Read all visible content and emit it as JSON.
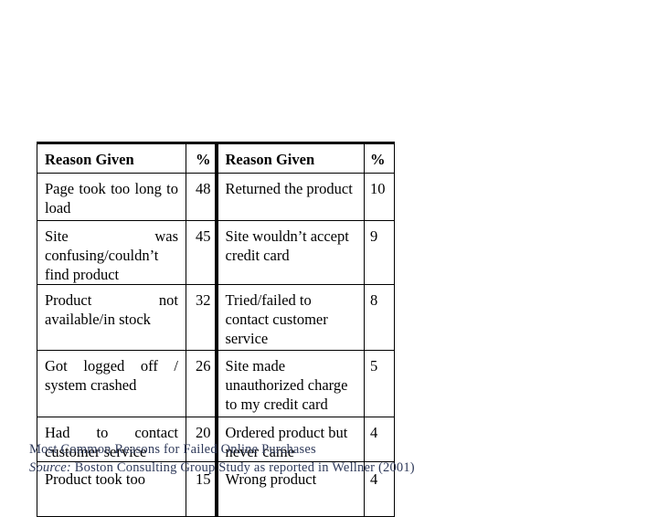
{
  "table": {
    "headers": [
      "Reason Given",
      "%",
      "Reason Given",
      "%"
    ],
    "rows": [
      {
        "reason_a": "Page took too long to load",
        "pct_a": "48",
        "reason_b": "Returned the product",
        "pct_b": "10"
      },
      {
        "reason_a": "Site was confusing/couldn’t find product",
        "pct_a": "45",
        "reason_b": "Site wouldn’t accept credit card",
        "pct_b": "9"
      },
      {
        "reason_a": "Product not available/in stock",
        "pct_a": "32",
        "reason_b": "Tried/failed to contact customer service",
        "pct_b": "8"
      },
      {
        "reason_a": "Got logged off / system crashed",
        "pct_a": "26",
        "reason_b": "Site made unauthorized charge to my credit card",
        "pct_b": "5"
      },
      {
        "reason_a": "Had to contact customer service",
        "pct_a": "20",
        "reason_b": "Ordered product but never came",
        "pct_b": "4"
      },
      {
        "reason_a": "Product took too",
        "pct_a": "15",
        "reason_b": "Wrong product",
        "pct_b": "4"
      }
    ]
  },
  "caption": "Most Common Reasons for Failed Online Purchases",
  "source": {
    "label": "Source:",
    "text": " Boston Consulting Group Study as reported in Wellner (2001)"
  }
}
